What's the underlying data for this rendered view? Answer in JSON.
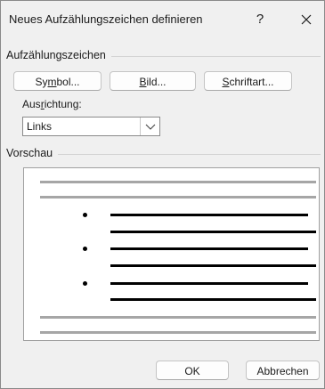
{
  "dialog": {
    "title": "Neues Aufzählungszeichen definieren",
    "help_glyph": "?",
    "close_glyph": "✕"
  },
  "bullet_group": {
    "label": "Aufzählungszeichen",
    "symbol_button": {
      "label": "Symbol...",
      "underline_char": "m"
    },
    "picture_button": {
      "label": "Bild...",
      "underline_char": "B"
    },
    "font_button": {
      "label": "Schriftart...",
      "underline_char": "S"
    }
  },
  "alignment": {
    "label": "Ausrichtung:",
    "underline_char": "r",
    "selected_value": "Links",
    "dropdown_icon": "chevron-down-icon"
  },
  "preview_group": {
    "label": "Vorschau",
    "bullet_glyph": "•"
  },
  "footer": {
    "ok_label": "OK",
    "cancel_label": "Abbrechen"
  }
}
